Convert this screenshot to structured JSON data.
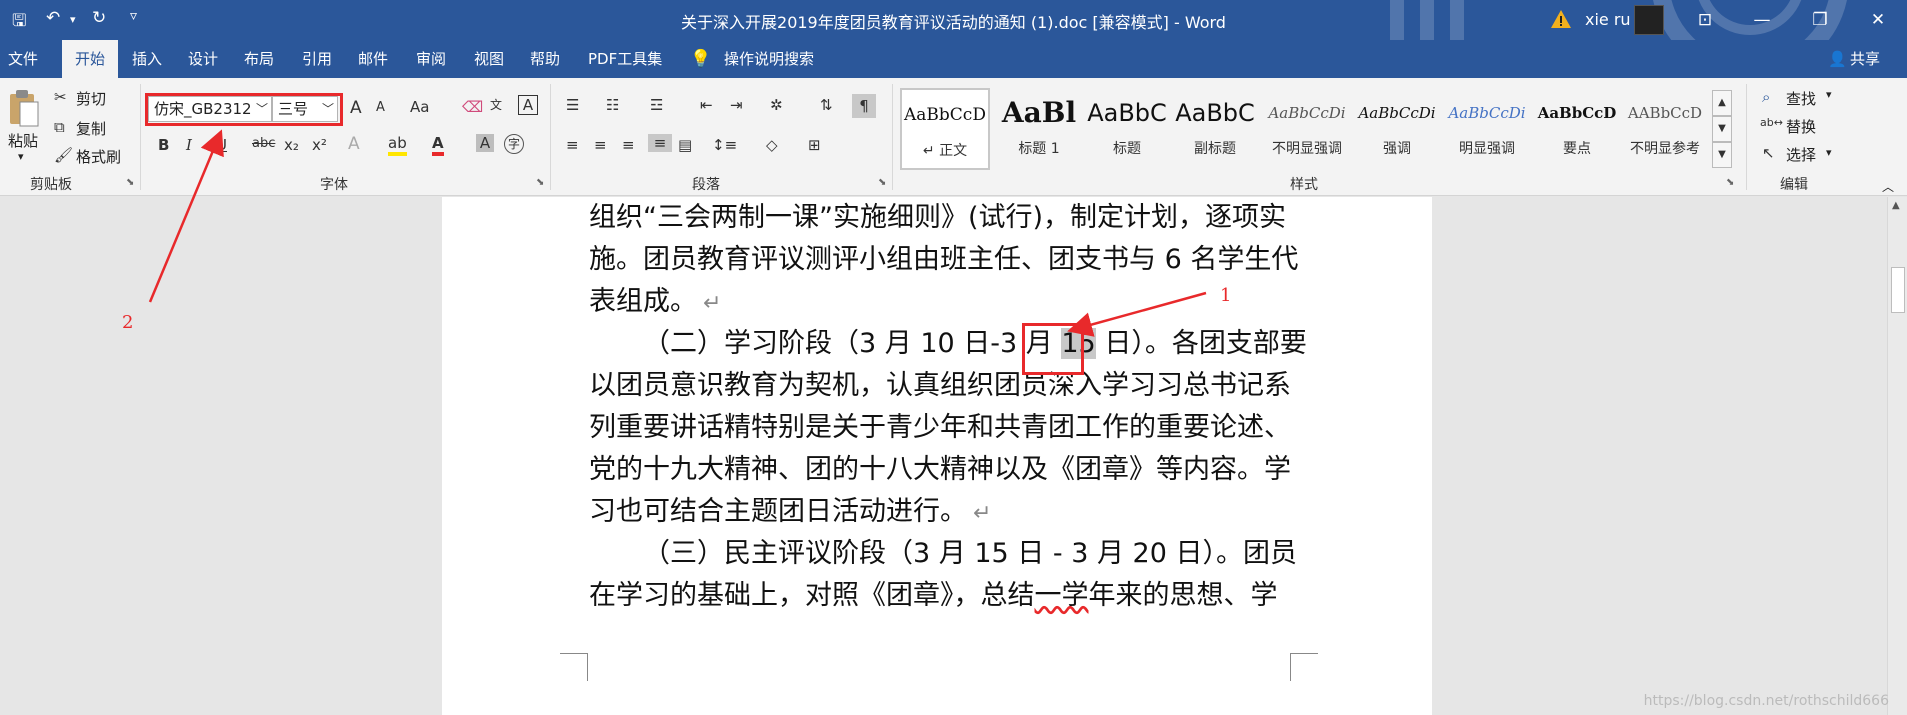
{
  "title_bar": {
    "doc_title": "关于深入开展2019年度团员教育评议活动的通知 (1).doc [兼容模式] - Word",
    "user": "xie ru",
    "qa_save": "🖫",
    "qa_undo": "↶",
    "qa_undo_dd": "▾",
    "qa_redo": "↻",
    "qa_customize": "▿",
    "ribbon_options": "⊡",
    "minimize": "—",
    "restore": "❐",
    "close": "✕"
  },
  "tabs": [
    {
      "label": "文件"
    },
    {
      "label": "开始"
    },
    {
      "label": "插入"
    },
    {
      "label": "设计"
    },
    {
      "label": "布局"
    },
    {
      "label": "引用"
    },
    {
      "label": "邮件"
    },
    {
      "label": "审阅"
    },
    {
      "label": "视图"
    },
    {
      "label": "帮助"
    },
    {
      "label": "PDF工具集"
    }
  ],
  "tell_me": "操作说明搜索",
  "share": "共享",
  "clipboard": {
    "paste": "粘贴",
    "cut": "剪切",
    "copy": "复制",
    "format_painter": "格式刷",
    "group_label": "剪贴板"
  },
  "font": {
    "font_name": "仿宋_GB2312",
    "font_size": "三号",
    "bold": "B",
    "italic": "I",
    "underline": "U",
    "strike": "abc",
    "subscript": "x₂",
    "superscript": "x²",
    "grow": "A",
    "shrink": "A",
    "case": "Aa",
    "group_label": "字体"
  },
  "paragraph": {
    "group_label": "段落"
  },
  "styles": {
    "items": [
      {
        "sample": "AaBbCcD",
        "name": "↵ 正文"
      },
      {
        "sample": "AaBl",
        "name": "标题 1"
      },
      {
        "sample": "AaBbC",
        "name": "标题"
      },
      {
        "sample": "AaBbC",
        "name": "副标题"
      },
      {
        "sample": "AaBbCcDi",
        "name": "不明显强调"
      },
      {
        "sample": "AaBbCcDi",
        "name": "强调"
      },
      {
        "sample": "AaBbCcDi",
        "name": "明显强调"
      },
      {
        "sample": "AaBbCcD",
        "name": "要点"
      },
      {
        "sample": "AABbCcD",
        "name": "不明显参考"
      }
    ],
    "group_label": "样式"
  },
  "editing": {
    "find": "查找",
    "replace": "替换",
    "select": "选择",
    "group_label": "编辑"
  },
  "document": {
    "lines": [
      {
        "text": "组织“三会两制一课”实施细则》(试行)，制定计划，逐项实"
      },
      {
        "text": "施。团员教育评议测评小组由班主任、团支书与 6 名学生代"
      },
      {
        "text": "表组成。"
      },
      {
        "pre": "（二）学习阶段（3 月 10 日-3 月 ",
        "hl": "15",
        "post": " 日）。各团支部要"
      },
      {
        "text": "以团员意识教育为契机，认真组织团员深入学习习总书记系"
      },
      {
        "text": "列重要讲话精特别是关于青少年和共青团工作的重要论述、"
      },
      {
        "text": "党的十九大精神、团的十八大精神以及《团章》等内容。学"
      },
      {
        "text": "习也可结合主题团日活动进行。"
      },
      {
        "text": "（三）民主评议阶段（3 月 15 日 - 3 月 20 日）。团员"
      },
      {
        "pre": "在学习的基础上，对照《团章》，总结",
        "sq": "一学",
        "post": "年来的思想、学"
      }
    ],
    "para_mark": "↵"
  },
  "annotations": {
    "label1": "1",
    "label2": "2"
  },
  "watermark": "https://blog.csdn.net/rothschild666",
  "colors": {
    "brand": "#2b579a",
    "annotation": "#e8292b"
  }
}
